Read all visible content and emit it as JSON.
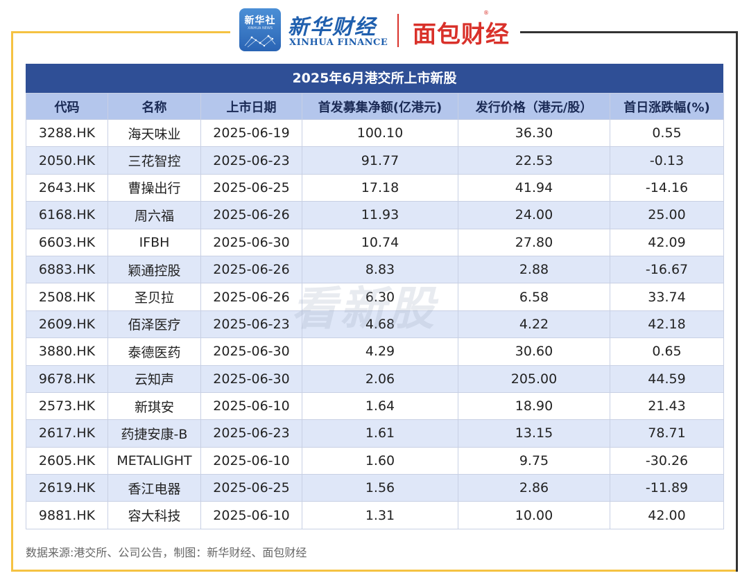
{
  "header": {
    "xinhua_logo_text": "新华社",
    "xinhua_logo_sub": "XINHUA NEWS",
    "xinhua_finance_cn": "新华财经",
    "xinhua_finance_en": "XINHUA FINANCE",
    "mianbao_caijing": "面包财经",
    "reg_mark": "®"
  },
  "watermark": "看新股",
  "colors": {
    "title_bar": "#2f4f96",
    "header_row": "#b4c6ec",
    "stripe_row": "#dfe7f8",
    "frame_gold": "#f5c242",
    "brand_red": "#d9312a",
    "brand_blue": "#1f5fae"
  },
  "chart_data": {
    "type": "table",
    "title": "2025年6月港交所上市新股",
    "columns": [
      "代码",
      "名称",
      "上市日期",
      "首发募集净额(亿港元)",
      "发行价格（港元/股）",
      "首日涨跌幅(%)"
    ],
    "rows": [
      [
        "3288.HK",
        "海天味业",
        "2025-06-19",
        "100.10",
        "36.30",
        "0.55"
      ],
      [
        "2050.HK",
        "三花智控",
        "2025-06-23",
        "91.77",
        "22.53",
        "-0.13"
      ],
      [
        "2643.HK",
        "曹操出行",
        "2025-06-25",
        "17.18",
        "41.94",
        "-14.16"
      ],
      [
        "6168.HK",
        "周六福",
        "2025-06-26",
        "11.93",
        "24.00",
        "25.00"
      ],
      [
        "6603.HK",
        "IFBH",
        "2025-06-30",
        "10.74",
        "27.80",
        "42.09"
      ],
      [
        "6883.HK",
        "颖通控股",
        "2025-06-26",
        "8.83",
        "2.88",
        "-16.67"
      ],
      [
        "2508.HK",
        "圣贝拉",
        "2025-06-26",
        "6.30",
        "6.58",
        "33.74"
      ],
      [
        "2609.HK",
        "佰泽医疗",
        "2025-06-23",
        "4.68",
        "4.22",
        "42.18"
      ],
      [
        "3880.HK",
        "泰德医药",
        "2025-06-30",
        "4.29",
        "30.60",
        "0.65"
      ],
      [
        "9678.HK",
        "云知声",
        "2025-06-30",
        "2.06",
        "205.00",
        "44.59"
      ],
      [
        "2573.HK",
        "新琪安",
        "2025-06-10",
        "1.64",
        "18.90",
        "21.43"
      ],
      [
        "2617.HK",
        "药捷安康-B",
        "2025-06-23",
        "1.61",
        "13.15",
        "78.71"
      ],
      [
        "2605.HK",
        "METALIGHT",
        "2025-06-10",
        "1.60",
        "9.75",
        "-30.26"
      ],
      [
        "2619.HK",
        "香江电器",
        "2025-06-25",
        "1.56",
        "2.86",
        "-11.89"
      ],
      [
        "9881.HK",
        "容大科技",
        "2025-06-10",
        "1.31",
        "10.00",
        "42.00"
      ]
    ]
  },
  "footer": {
    "source": "数据来源:港交所、公司公告，制图：新华财经、面包财经"
  }
}
